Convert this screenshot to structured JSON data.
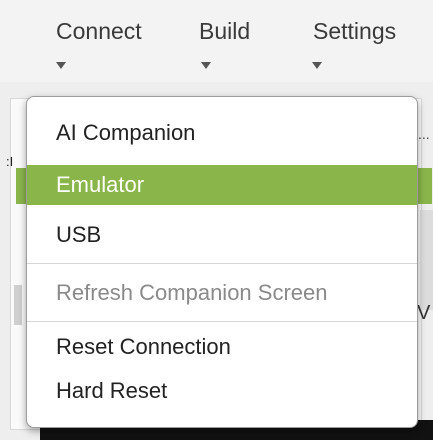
{
  "menubar": {
    "connect": "Connect",
    "build": "Build",
    "settings": "Settings"
  },
  "background": {
    "left_char": ":I",
    "right_dots": "...",
    "right_letter": "V"
  },
  "dropdown": {
    "items": [
      {
        "label": "AI Companion",
        "state": "normal"
      },
      {
        "label": "Emulator",
        "state": "selected"
      },
      {
        "label": "USB",
        "state": "normal"
      },
      {
        "label": "Refresh Companion Screen",
        "state": "disabled"
      },
      {
        "label": "Reset Connection",
        "state": "normal"
      },
      {
        "label": "Hard Reset",
        "state": "normal"
      }
    ],
    "selected_color": "#8ab54b"
  }
}
